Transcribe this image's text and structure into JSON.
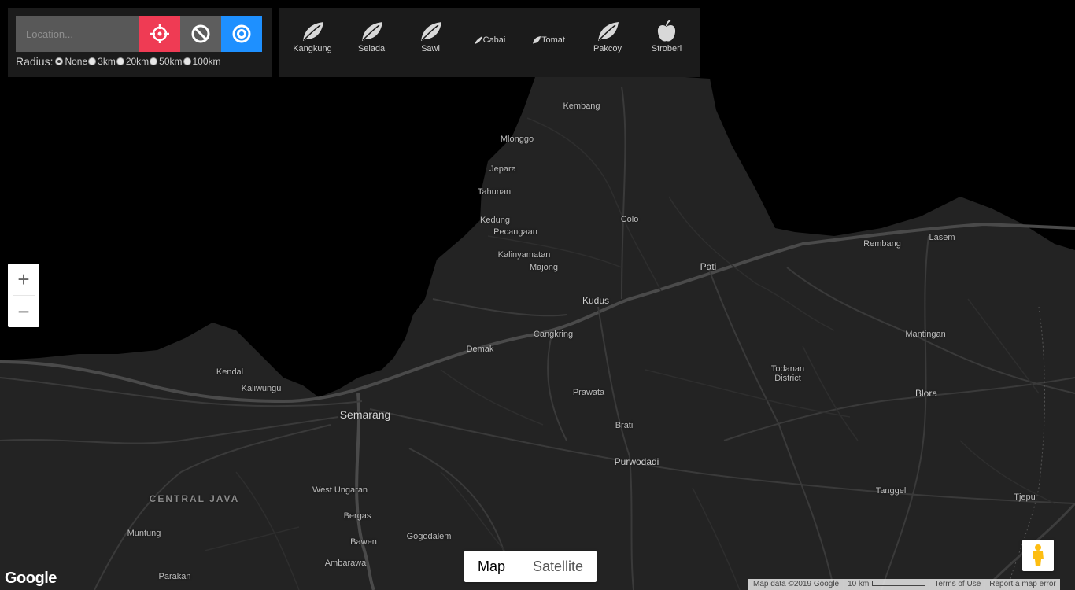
{
  "search": {
    "placeholder": "Location...",
    "radius_label": "Radius:",
    "radius_options": [
      "None",
      "3km",
      "20km",
      "50km",
      "100km"
    ],
    "radius_selected": "None"
  },
  "buttons": {
    "locate_icon": "crosshair-icon",
    "clear_icon": "ban-icon",
    "radius_icon": "target-icon",
    "locate_color": "#ef3b54",
    "clear_color": "#5d5d5d",
    "radius_color": "#1e90ff"
  },
  "plants": [
    {
      "label": "Kangkung",
      "icon": "leaf-icon"
    },
    {
      "label": "Selada",
      "icon": "leaf-icon"
    },
    {
      "label": "Sawi",
      "icon": "leaf-icon"
    },
    {
      "label": "Cabai",
      "icon": "chili-icon"
    },
    {
      "label": "Tomat",
      "icon": "leaf-icon"
    },
    {
      "label": "Pakcoy",
      "icon": "leaf-icon"
    },
    {
      "label": "Stroberi",
      "icon": "apple-icon"
    }
  ],
  "map": {
    "places": [
      {
        "name": "Kembang"
      },
      {
        "name": "Mlonggo"
      },
      {
        "name": "Jepara"
      },
      {
        "name": "Tahunan"
      },
      {
        "name": "Kedung"
      },
      {
        "name": "Pecangaan"
      },
      {
        "name": "Kalinyamatan"
      },
      {
        "name": "Majong"
      },
      {
        "name": "Colo"
      },
      {
        "name": "Pati"
      },
      {
        "name": "Rembang"
      },
      {
        "name": "Lasem"
      },
      {
        "name": "Kudus"
      },
      {
        "name": "Cangkring"
      },
      {
        "name": "Demak"
      },
      {
        "name": "Mantingan"
      },
      {
        "name": "Todanan"
      },
      {
        "name": "District"
      },
      {
        "name": "Blora"
      },
      {
        "name": "Kendal"
      },
      {
        "name": "Kaliwungu"
      },
      {
        "name": "Semarang"
      },
      {
        "name": "Prawata"
      },
      {
        "name": "Brati"
      },
      {
        "name": "Purwodadi"
      },
      {
        "name": "CENTRAL JAVA"
      },
      {
        "name": "West Ungaran"
      },
      {
        "name": "Tanggel"
      },
      {
        "name": "Tjepu"
      },
      {
        "name": "Bergas"
      },
      {
        "name": "Muntung"
      },
      {
        "name": "Gogodalem"
      },
      {
        "name": "Bawen"
      },
      {
        "name": "Ambarawa"
      },
      {
        "name": "Parakan"
      }
    ]
  },
  "zoom": {
    "in_label": "+",
    "out_label": "−"
  },
  "maptype": {
    "map_label": "Map",
    "satellite_label": "Satellite",
    "active": "Map"
  },
  "logo": "Google",
  "footer": {
    "data": "Map data ©2019 Google",
    "scale": "10 km",
    "terms": "Terms of Use",
    "report": "Report a map error"
  }
}
